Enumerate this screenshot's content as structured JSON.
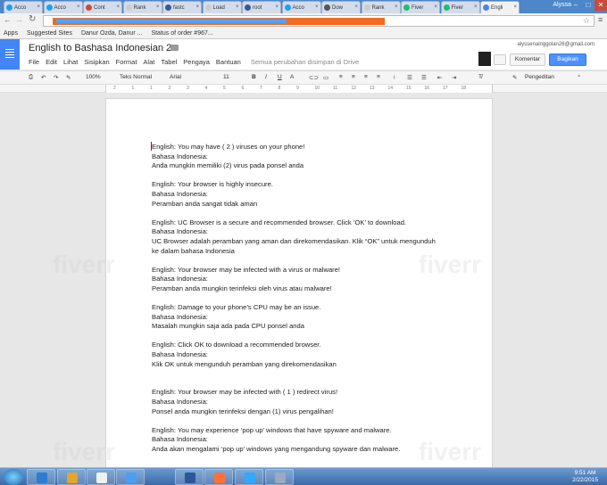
{
  "browser": {
    "tabs": [
      {
        "label": "Acco",
        "color": "#1da1f2"
      },
      {
        "label": "Acco",
        "color": "#1da1f2"
      },
      {
        "label": "Cont",
        "color": "#d44638"
      },
      {
        "label": "Rank",
        "color": "#cccccc"
      },
      {
        "label": "fastc",
        "color": "#3b5998"
      },
      {
        "label": "Load",
        "color": "#cccccc"
      },
      {
        "label": "root",
        "color": "#3b5998"
      },
      {
        "label": "Acco",
        "color": "#1da1f2"
      },
      {
        "label": "Dow",
        "color": "#555555"
      },
      {
        "label": "Rank",
        "color": "#cccccc"
      },
      {
        "label": "Fiver",
        "color": "#1dbf73"
      },
      {
        "label": "Fiver",
        "color": "#1dbf73"
      },
      {
        "label": "Engli",
        "color": "#4285f4"
      }
    ],
    "user": "Alyssa",
    "bookmarks": [
      "Apps",
      "Suggested Sites",
      "Danur Ozda, Danur ...",
      "Status of order #967..."
    ]
  },
  "doc": {
    "title": "English to Bashasa Indonesian 2",
    "menu": [
      "File",
      "Edit",
      "Lihat",
      "Sisipkan",
      "Format",
      "Alat",
      "Tabel",
      "Pengaya",
      "Bantuan"
    ],
    "save_status": "Semua perubahan disimpan di Drive",
    "account": "alyssenainggolan26@gmail.com",
    "comment_label": "Komentar",
    "share_label": "Bagikan"
  },
  "format_bar": {
    "zoom": "100%",
    "style": "Teks Normal",
    "font": "Arial",
    "size": "11",
    "mode": "Pengeditan"
  },
  "ruler": [
    "2",
    "1",
    "1",
    "2",
    "3",
    "4",
    "5",
    "6",
    "7",
    "8",
    "9",
    "10",
    "11",
    "12",
    "13",
    "14",
    "15",
    "16",
    "17",
    "18"
  ],
  "content": [
    "English: You may have ( 2 ) viruses on your phone!",
    "Bahasa Indonesia:",
    "Anda mungkin memiliki (2) virus pada ponsel anda",
    "",
    "English: Your browser is highly insecure.",
    "Bahasa Indonesia:",
    "Peramban anda sangat tidak aman",
    "",
    "English: UC Browser is a secure and recommended browser. Click ‘OK’ to download.",
    "Bahasa Indonesia:",
    "UC Browser adalah peramban yang aman dan direkomendasikan. Klik “OK” untuk mengunduh",
    "ke dalam bahasa Indonesia",
    "",
    "English: Your browser may be infected with a virus or malware!",
    "Bahasa Indonesia:",
    "Peramban anda mungkin terinfeksi oleh virus atau malware!",
    "",
    "English: Damage to your phone’s CPU may be an issue.",
    "Bahasa Indonesia:",
    "Masalah mungkin saja ada pada CPU ponsel anda",
    "",
    "English: Click OK to download a recommended browser.",
    "Bahasa Indonesia:",
    "Klik OK untuk mengunduh peramban yang direkomendasikan",
    "",
    "",
    "English: Your browser may be infected with ( 1 ) redirect virus!",
    "Bahasa Indonesia:",
    "Ponsel anda mungkin terinfeksi dengan (1) virus pengalihan!",
    "",
    "English: You may experience ‘pop up’ windows that have spyware and malware.",
    "Bahasa Indonesia:",
    "Anda akan mengalami ‘pop up’ windows yang mengandung spyware dan malware."
  ],
  "taskbar": {
    "time": "9:51 AM",
    "date": "2/22/2015",
    "apps": [
      "#2b7cd3",
      "#e3a52a",
      "#f0f0f0",
      "#4c9ef1",
      "#2b579a",
      "#ff7139",
      "#31a8ff",
      "#9aa8c0"
    ]
  }
}
